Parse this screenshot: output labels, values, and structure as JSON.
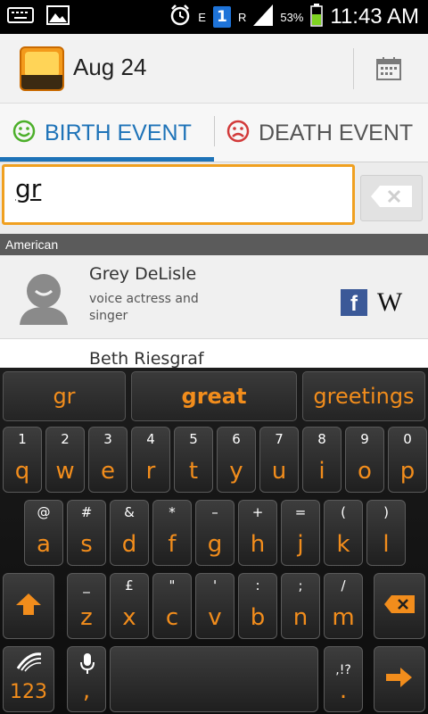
{
  "status_bar": {
    "network_type": "E",
    "sim_badge": "1",
    "signal_letter": "R",
    "battery_percent": "53%",
    "time": "11:43 AM",
    "icons": [
      "keyboard-icon",
      "image-icon",
      "alarm-icon",
      "signal-icon",
      "battery-icon"
    ]
  },
  "action_bar": {
    "logo_alt": "app-logo",
    "date": "Aug 24",
    "calendar_icon": "calendar-icon"
  },
  "tabs": [
    {
      "label": "BIRTH EVENT",
      "icon": "happy-face-icon",
      "active": true
    },
    {
      "label": "DEATH EVENT",
      "icon": "sad-face-icon",
      "active": false
    }
  ],
  "search": {
    "value": "gr",
    "clear_icon": "backspace-clear-icon"
  },
  "section": {
    "title": "American"
  },
  "list": [
    {
      "name": "Grey DeLisle",
      "description": "voice actress and singer",
      "facebook": "f",
      "wikipedia": "W"
    },
    {
      "name": "Beth Riesgraf",
      "description": ""
    }
  ],
  "keyboard": {
    "suggestions": [
      "gr",
      "great",
      "greetings"
    ],
    "row1": [
      {
        "sec": "1",
        "pri": "q"
      },
      {
        "sec": "2",
        "pri": "w"
      },
      {
        "sec": "3",
        "pri": "e"
      },
      {
        "sec": "4",
        "pri": "r"
      },
      {
        "sec": "5",
        "pri": "t"
      },
      {
        "sec": "6",
        "pri": "y"
      },
      {
        "sec": "7",
        "pri": "u"
      },
      {
        "sec": "8",
        "pri": "i"
      },
      {
        "sec": "9",
        "pri": "o"
      },
      {
        "sec": "0",
        "pri": "p"
      }
    ],
    "row2": [
      {
        "sec": "@",
        "pri": "a"
      },
      {
        "sec": "#",
        "pri": "s"
      },
      {
        "sec": "&",
        "pri": "d"
      },
      {
        "sec": "*",
        "pri": "f"
      },
      {
        "sec": "–",
        "pri": "g"
      },
      {
        "sec": "+",
        "pri": "h"
      },
      {
        "sec": "=",
        "pri": "j"
      },
      {
        "sec": "(",
        "pri": "k"
      },
      {
        "sec": ")",
        "pri": "l"
      }
    ],
    "row3": [
      {
        "sec": "_",
        "pri": "z"
      },
      {
        "sec": "£",
        "pri": "x"
      },
      {
        "sec": "\"",
        "pri": "c"
      },
      {
        "sec": "'",
        "pri": "v"
      },
      {
        "sec": ":",
        "pri": "b"
      },
      {
        "sec": ";",
        "pri": "n"
      },
      {
        "sec": "/",
        "pri": "m"
      }
    ],
    "numbers_key": "123",
    "comma_key": {
      "sec": "",
      "pri": ","
    },
    "period_key": {
      "sec": ",!?",
      "pri": "."
    },
    "accent_color": "#f28d1c"
  }
}
